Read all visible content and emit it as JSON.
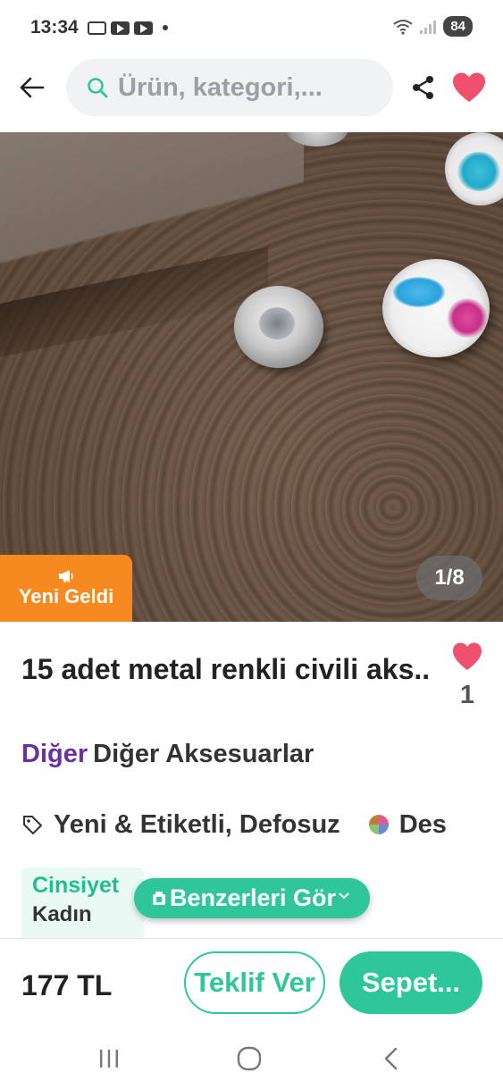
{
  "status_bar": {
    "time": "13:34",
    "battery": "84"
  },
  "header": {
    "search_placeholder": "Ürün, kategori,..."
  },
  "gallery": {
    "badge": "Yeni Geldi",
    "counter": "1/8"
  },
  "product": {
    "title": "15 adet metal renkli civili aks..",
    "likes": "1",
    "category_main": "Diğer",
    "category_sub": "Diğer Aksesuarlar",
    "condition": "Yeni & Etiketli, Defosuz",
    "brand": "Des",
    "spec_label": "Cinsiyet",
    "spec_value": "Kadın",
    "similar_button": "Benzerleri Gör"
  },
  "bottom_bar": {
    "price": "177 TL",
    "offer_button": "Teklif Ver",
    "cart_button": "Sepet..."
  },
  "icons": {
    "back": "arrow-left-icon",
    "search": "search-icon",
    "share": "share-icon",
    "favorite": "heart-icon",
    "tag": "tag-icon",
    "megaphone": "megaphone-icon"
  },
  "colors": {
    "accent_green": "#2fc79a",
    "badge_orange": "#f6891f",
    "heart_red": "#f0506e",
    "category_purple": "#6b2fa0"
  }
}
